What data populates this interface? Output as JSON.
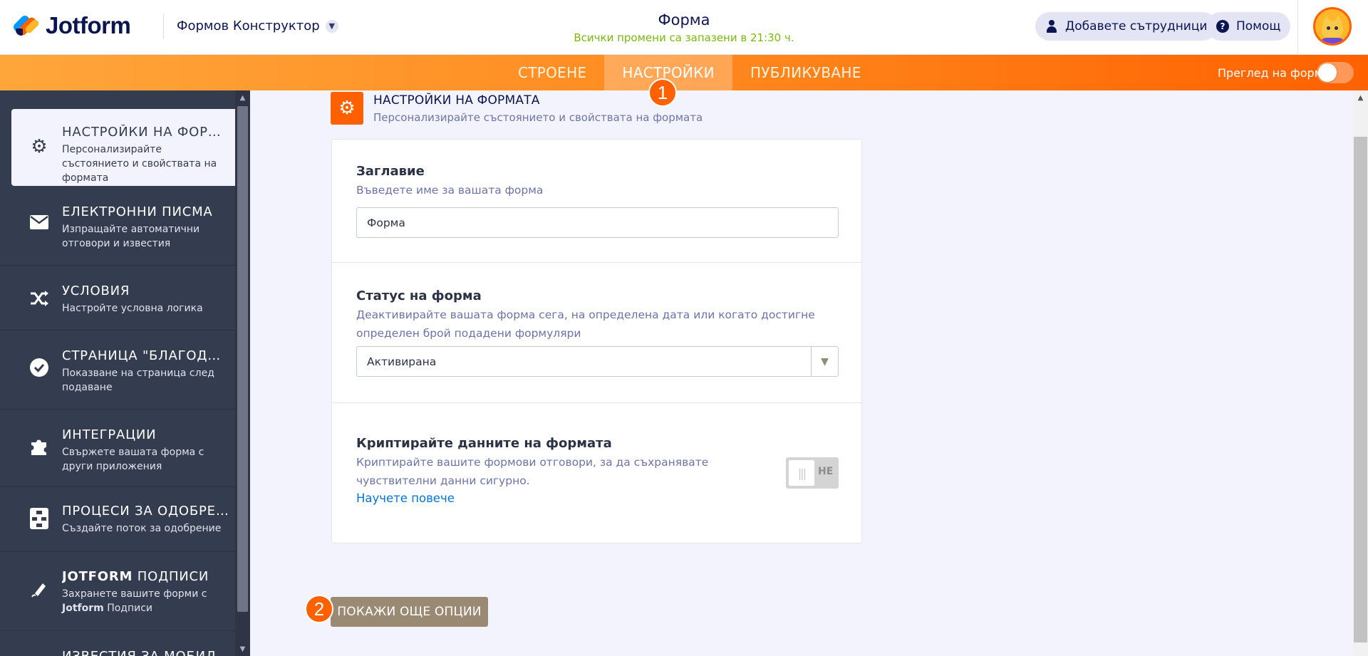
{
  "header": {
    "logo_text": "Jotform",
    "builder_menu": "Формов Конструктор",
    "form_title": "Форма",
    "save_status": "Всички промени са запазени в 21:30 ч.",
    "collaborators_label": "Добавете сътрудници",
    "help_label": "Помощ"
  },
  "nav": {
    "tabs": [
      {
        "label": "СТРОЕНЕ",
        "active": false
      },
      {
        "label": "НАСТРОЙКИ",
        "active": true
      },
      {
        "label": "ПУБЛИКУВАНЕ",
        "active": false
      }
    ],
    "preview_label": "Преглед на форма",
    "preview_on": false
  },
  "sidebar": {
    "items": [
      {
        "title": "НАСТРОЙКИ НА ФОРМ...",
        "desc": "Персонализирайте състоянието и свойствата на формата",
        "icon": "gear-icon",
        "active": true
      },
      {
        "title": "ЕЛЕКТРОННИ ПИСМА",
        "desc": "Изпращайте автоматични отговори и известия",
        "icon": "envelope-icon"
      },
      {
        "title": "УСЛОВИЯ",
        "desc": "Настройте условна логика",
        "icon": "shuffle-icon"
      },
      {
        "title": "СТРАНИЦА \"БЛАГОДАРЯ\"",
        "desc": "Показване на страница след подаване",
        "icon": "check-circle-icon"
      },
      {
        "title": "ИНТЕГРАЦИИ",
        "desc": "Свържете вашата форма с други приложения",
        "icon": "puzzle-icon"
      },
      {
        "title": "ПРОЦЕСИ ЗА ОДОБРЕН...",
        "desc": "Създайте поток за одобрение",
        "icon": "flow-icon"
      },
      {
        "title_bold": "JOTFORM",
        "title": "ПОДПИСИ",
        "desc_pre": "Захранете вашите форми с",
        "desc_bold": "Jotform",
        "desc_post": "Подписи",
        "icon": "pen-icon"
      },
      {
        "title": "ИЗВЕСТИЯ ЗА МОБИЛН...",
        "desc": "",
        "icon": "bell-icon"
      }
    ]
  },
  "section": {
    "title": "НАСТРОЙКИ НА ФОРМАТА",
    "subtitle": "Персонализирайте състоянието и свойствата на формата"
  },
  "fields": {
    "title": {
      "label": "Заглавие",
      "desc": "Въведете име за вашата форма",
      "value": "Форма"
    },
    "status": {
      "label": "Статус на форма",
      "desc": "Деактивирайте вашата форма сега, на определена дата или когато достигне определен брой подадени формуляри",
      "value": "Активирана"
    },
    "encrypt": {
      "label": "Криптирайте данните на формата",
      "desc": "Криптирайте вашите формови отговори, за да съхранявате чувствителни данни сигурно.",
      "link": "Научете повече",
      "toggle_label": "НЕ",
      "toggle_on": false
    }
  },
  "more_options_label": "ПОКАЖИ ОЩЕ ОПЦИИ",
  "annotations": {
    "badge_1": "1",
    "badge_2": "2"
  },
  "colors": {
    "accent": "#ff6100",
    "sidebar_bg": "#343c50",
    "link": "#0075e3",
    "saved_green": "#78bb07",
    "more_button": "#9b8a73"
  }
}
